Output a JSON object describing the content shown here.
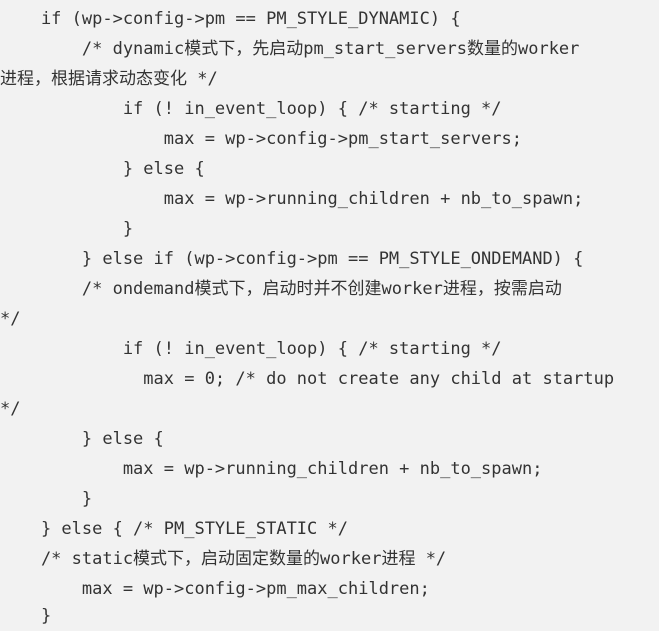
{
  "code": {
    "lines": [
      "    if (wp->config->pm == PM_STYLE_DYNAMIC) {",
      "        /* dynamic模式下，先启动pm_start_servers数量的worker",
      "进程，根据请求动态变化 */",
      "            if (! in_event_loop) { /* starting */",
      "                max = wp->config->pm_start_servers;",
      "            } else {",
      "                max = wp->running_children + nb_to_spawn;",
      "            }",
      "        } else if (wp->config->pm == PM_STYLE_ONDEMAND) {",
      "        /* ondemand模式下，启动时并不创建worker进程，按需启动",
      "*/",
      "            if (! in_event_loop) { /* starting */",
      "              max = 0; /* do not create any child at startup",
      "*/",
      "        } else {",
      "            max = wp->running_children + nb_to_spawn;",
      "        }",
      "    } else { /* PM_STYLE_STATIC */",
      "    /* static模式下，启动固定数量的worker进程 */",
      "        max = wp->config->pm_max_children;",
      "    }"
    ]
  }
}
